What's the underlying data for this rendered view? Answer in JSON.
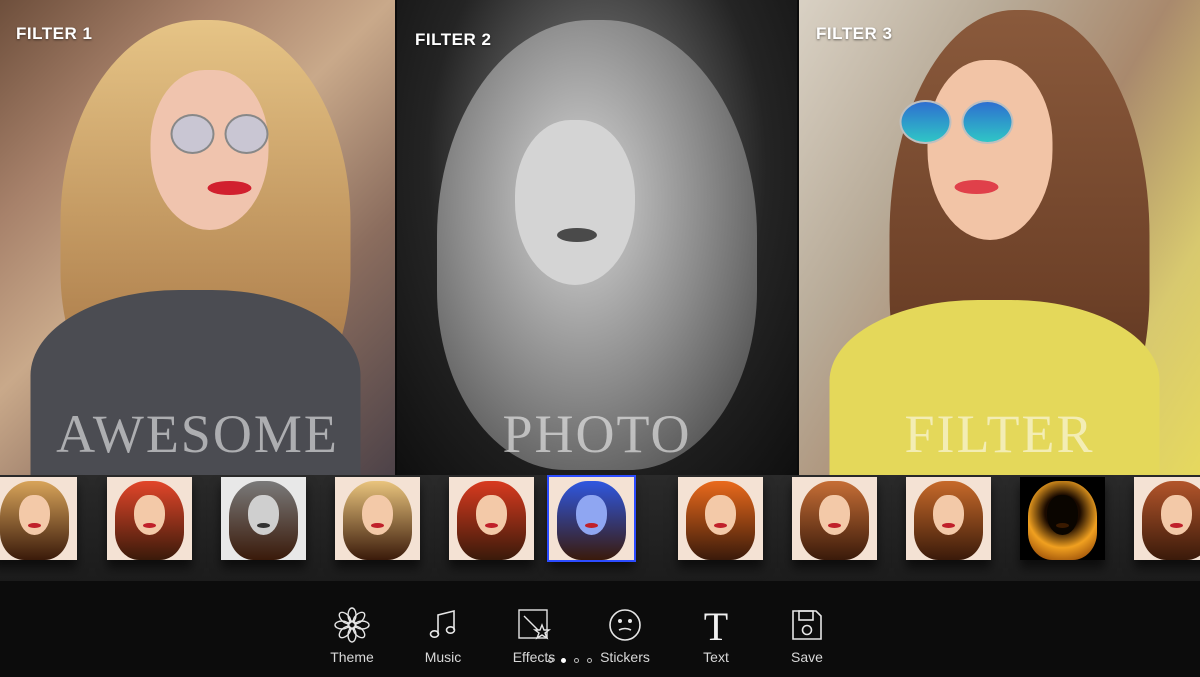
{
  "panels": [
    {
      "label": "FILTER 1",
      "word": "AWESOME"
    },
    {
      "label": "FILTER 2",
      "word": "PHOTO"
    },
    {
      "label": "FILTER 3",
      "word": "FILTER"
    }
  ],
  "thumbnails": [
    {
      "filter": "original",
      "tint": "#d8a45a"
    },
    {
      "filter": "warm-red",
      "tint": "#e2462a"
    },
    {
      "filter": "mono",
      "tint": "#7a7a7a"
    },
    {
      "filter": "bright",
      "tint": "#e9c47d"
    },
    {
      "filter": "red",
      "tint": "#d83a1f"
    },
    {
      "filter": "blue",
      "tint": "#2f57e0",
      "selected": true
    },
    {
      "filter": "orange",
      "tint": "#ea6a1c"
    },
    {
      "filter": "sepia",
      "tint": "#c66e36"
    },
    {
      "filter": "amber",
      "tint": "#c76a2a"
    },
    {
      "filter": "fire",
      "tint": "#1a0f05"
    },
    {
      "filter": "copper",
      "tint": "#b3552b"
    }
  ],
  "toolbar": {
    "items": [
      {
        "label": "Theme",
        "icon": "flower-icon"
      },
      {
        "label": "Music",
        "icon": "music-note-icon"
      },
      {
        "label": "Effects",
        "icon": "magic-wand-icon"
      },
      {
        "label": "Stickers",
        "icon": "smiley-face-icon"
      },
      {
        "label": "Text",
        "icon": "text-t-icon"
      },
      {
        "label": "Save",
        "icon": "floppy-disk-icon"
      }
    ]
  },
  "pager": {
    "count": 4,
    "active": 1
  },
  "colors": {
    "background": "#0b0b0b",
    "strip": "#222222",
    "selected_outline": "#2c4cff"
  }
}
